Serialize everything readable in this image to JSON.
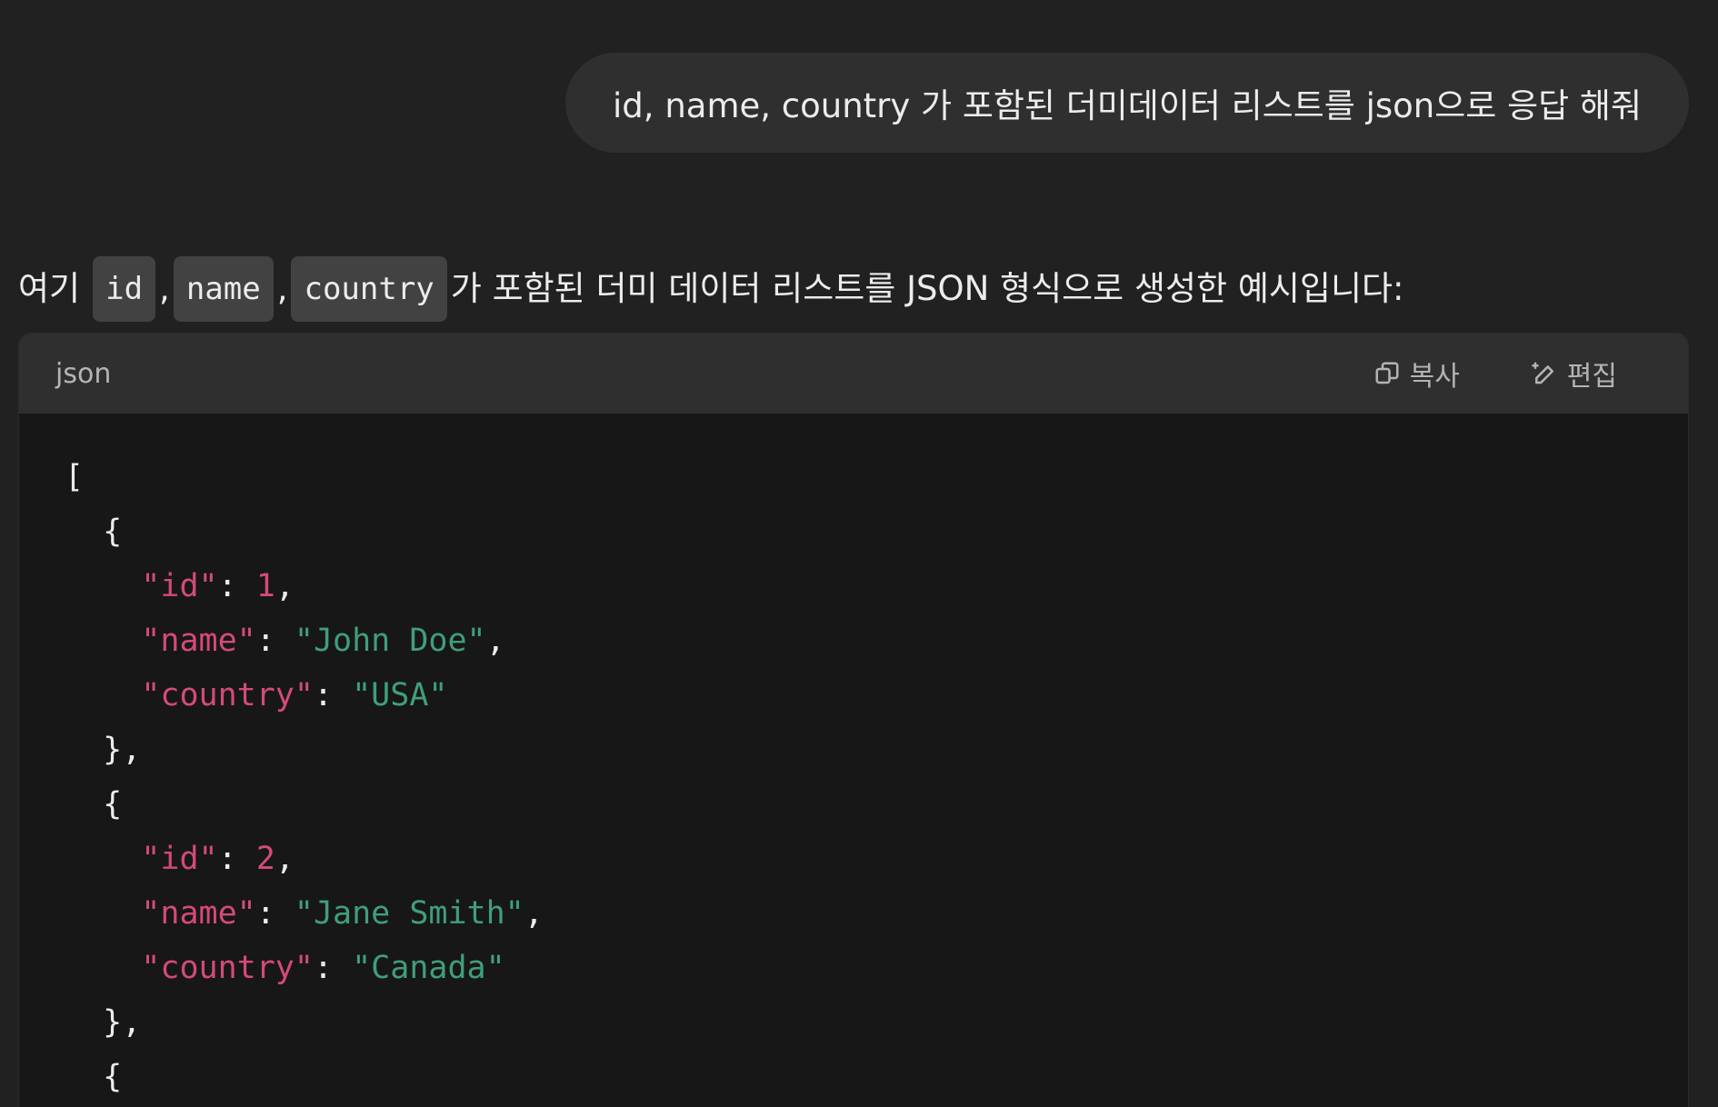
{
  "user_message": "id, name, country 가 포함된 더미데이터 리스트를 json으로 응답 해줘",
  "assistant": {
    "intro_prefix": "여기",
    "inline_codes": [
      "id",
      "name",
      "country"
    ],
    "sep1": ",",
    "sep2": ",",
    "intro_suffix": "가 포함된 더미 데이터 리스트를 JSON 형식으로 생성한 예시입니다:"
  },
  "code_block": {
    "language": "json",
    "copy_label": "복사",
    "edit_label": "편집",
    "lines": [
      {
        "indent": "",
        "parts": [
          {
            "t": "p",
            "v": "["
          }
        ]
      },
      {
        "indent": "  ",
        "parts": [
          {
            "t": "p",
            "v": "{"
          }
        ]
      },
      {
        "indent": "    ",
        "parts": [
          {
            "t": "k",
            "v": "\"id\""
          },
          {
            "t": "p",
            "v": ": "
          },
          {
            "t": "n",
            "v": "1"
          },
          {
            "t": "p",
            "v": ","
          }
        ]
      },
      {
        "indent": "    ",
        "parts": [
          {
            "t": "k",
            "v": "\"name\""
          },
          {
            "t": "p",
            "v": ": "
          },
          {
            "t": "s",
            "v": "\"John Doe\""
          },
          {
            "t": "p",
            "v": ","
          }
        ]
      },
      {
        "indent": "    ",
        "parts": [
          {
            "t": "k",
            "v": "\"country\""
          },
          {
            "t": "p",
            "v": ": "
          },
          {
            "t": "s",
            "v": "\"USA\""
          }
        ]
      },
      {
        "indent": "  ",
        "parts": [
          {
            "t": "p",
            "v": "},"
          }
        ]
      },
      {
        "indent": "  ",
        "parts": [
          {
            "t": "p",
            "v": "{"
          }
        ]
      },
      {
        "indent": "    ",
        "parts": [
          {
            "t": "k",
            "v": "\"id\""
          },
          {
            "t": "p",
            "v": ": "
          },
          {
            "t": "n",
            "v": "2"
          },
          {
            "t": "p",
            "v": ","
          }
        ]
      },
      {
        "indent": "    ",
        "parts": [
          {
            "t": "k",
            "v": "\"name\""
          },
          {
            "t": "p",
            "v": ": "
          },
          {
            "t": "s",
            "v": "\"Jane Smith\""
          },
          {
            "t": "p",
            "v": ","
          }
        ]
      },
      {
        "indent": "    ",
        "parts": [
          {
            "t": "k",
            "v": "\"country\""
          },
          {
            "t": "p",
            "v": ": "
          },
          {
            "t": "s",
            "v": "\"Canada\""
          }
        ]
      },
      {
        "indent": "  ",
        "parts": [
          {
            "t": "p",
            "v": "},"
          }
        ]
      },
      {
        "indent": "  ",
        "parts": [
          {
            "t": "p",
            "v": "{"
          }
        ]
      }
    ]
  },
  "colors": {
    "background": "#212121",
    "bubble": "#2f2f2f",
    "code_bg": "#171717",
    "key": "#d44a7a",
    "string": "#3f9f7a"
  }
}
